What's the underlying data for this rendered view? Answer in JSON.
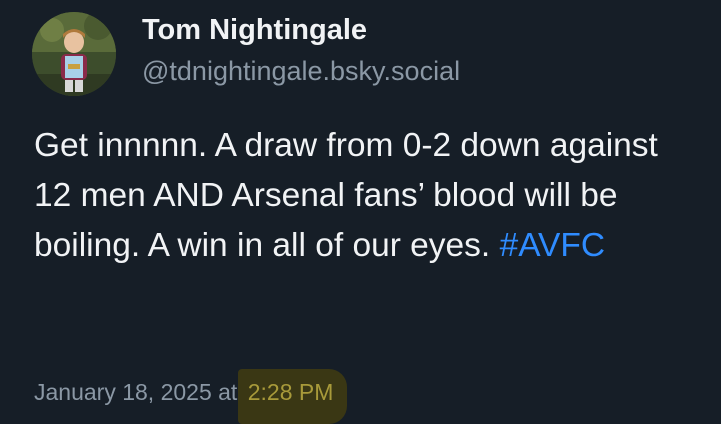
{
  "author": {
    "display_name": "Tom Nightingale",
    "handle": "@tdnightingale.bsky.social"
  },
  "post": {
    "text_before": "Get innnnn. A draw from 0-2 down against 12 men AND Arsenal fans’ blood will be boiling. A win in all of our eyes. ",
    "hashtag": "#AVFC"
  },
  "timestamp": {
    "date": "January 18, 2025 at ",
    "time": "2:28 PM"
  },
  "colors": {
    "background": "#161e27",
    "hashtag": "#2f8cff",
    "highlight": "#3a3714"
  },
  "icons": {
    "avatar": "profile-photo"
  }
}
